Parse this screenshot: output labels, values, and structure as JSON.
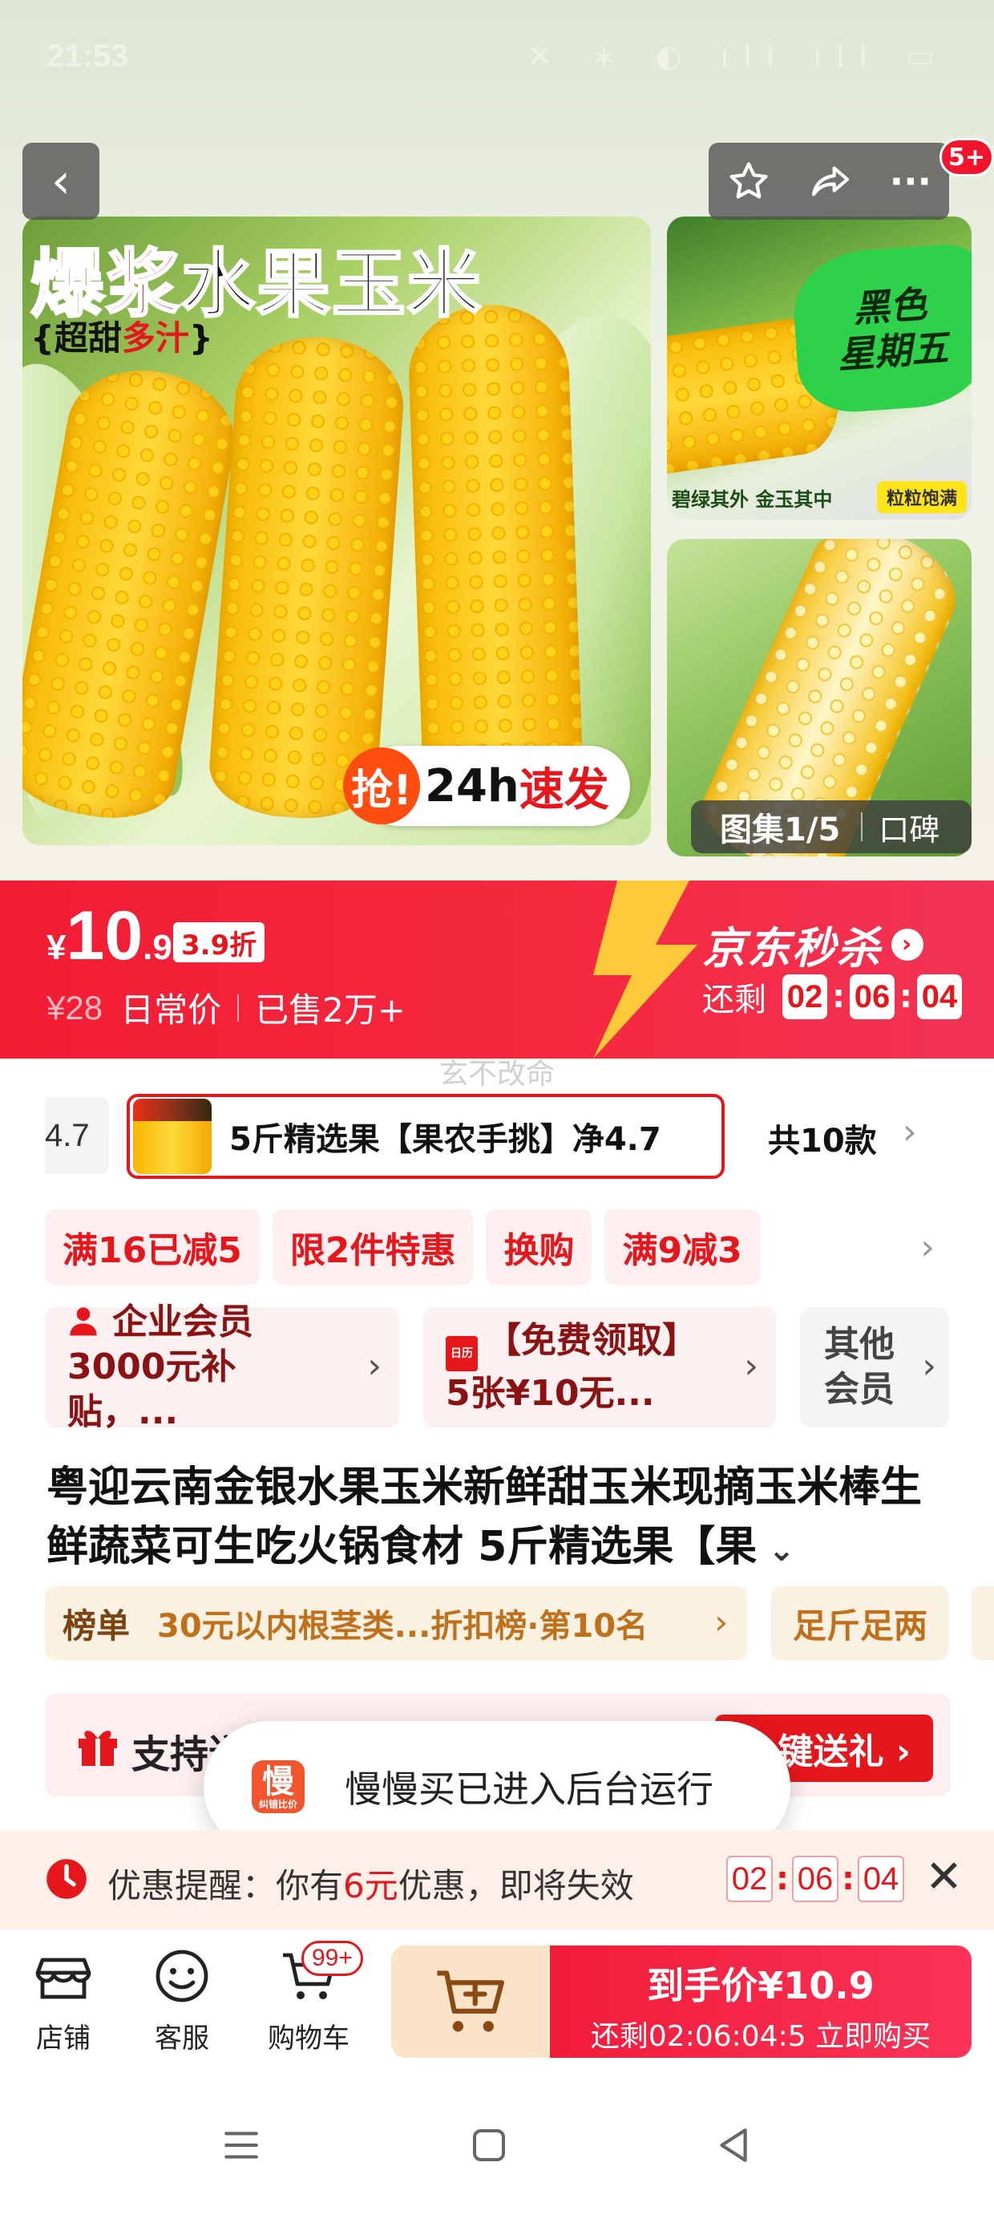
{
  "status_bar": {
    "time": "21:53",
    "icons": "✕ ∗ ◐ ıll ıll ▭"
  },
  "nav": {
    "back": "‹",
    "favorite_icon": "star-icon",
    "share_icon": "share-icon",
    "more": "···",
    "badge": "5+"
  },
  "gallery": {
    "main_title_red": "爆浆",
    "main_title_black": "水果玉米",
    "main_sub_prefix": "{超甜",
    "main_sub_red": "多汁",
    "main_sub_suffix": "}",
    "sticker_grab": "抢!",
    "sticker_hours": "24h",
    "sticker_fast": "速发",
    "thumb1_badge_line1": "黑色",
    "thumb1_badge_line2": "星期五",
    "thumb1_caption": "碧绿其外 金玉其中",
    "thumb1_tag": "粒粒饱满",
    "count_label": "图集1/5",
    "reviews_label": "口碑"
  },
  "price": {
    "currency": "¥",
    "integer": "10",
    "decimal": ".9",
    "discount": "3.9折",
    "original": "¥28",
    "original_label": "日常价",
    "sold": "已售2万+",
    "flash_title": "京东秒杀",
    "remaining_label": "还剩",
    "countdown": [
      "02",
      "06",
      "04"
    ]
  },
  "watermark": "玄不改命",
  "variants": {
    "prev_text": "4.7",
    "selected": "5斤精选果【果农手挑】净4.7",
    "total": "共10款",
    "more": "›"
  },
  "promos": [
    "满16已减5",
    "限2件特惠",
    "换购",
    "满9减3"
  ],
  "cards": {
    "enterprise": "企业会员3000元补贴，...",
    "coupon": "【免费领取】5张¥10无...",
    "coupon_icon_text": "日历",
    "other_members": "其他会员"
  },
  "product_title": "粤迎云南金银水果玉米新鲜甜玉米现摘玉米棒生鲜蔬菜可生吃火锅食材 5斤精选果【果",
  "ranking": {
    "label": "榜单",
    "text": "30元以内根茎类...折扣榜·第10名",
    "side_tag": "足斤足两"
  },
  "gift": {
    "text": "支持送",
    "button": "一键送礼 ›"
  },
  "toast": {
    "icon_char": "慢",
    "icon_small": "纠错比价",
    "text": "慢慢买已进入后台运行"
  },
  "reminder": {
    "prefix": "优惠提醒：你有",
    "amount": "6元",
    "suffix": "优惠，即将失效",
    "countdown": [
      "02",
      "06",
      "04"
    ],
    "close": "✕"
  },
  "bottom": {
    "store": "店铺",
    "service": "客服",
    "cart": "购物车",
    "cart_badge": "99+",
    "buy_main": "到手价¥10.9",
    "buy_sub": "还剩02:06:04:5 立即购买"
  },
  "colors": {
    "accent": "#e6171c",
    "flash_bg": "#f11d34",
    "add_cart_bg": "#fbe3c8"
  }
}
